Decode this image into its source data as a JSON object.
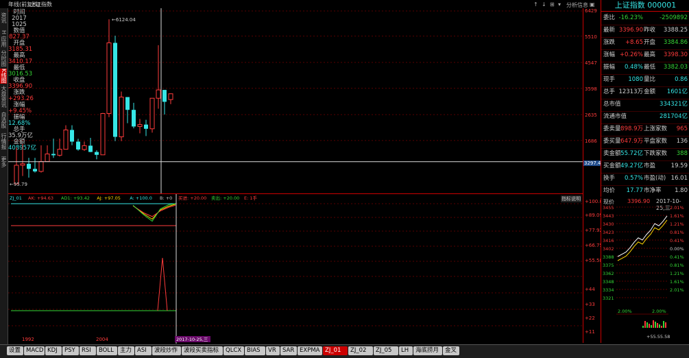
{
  "window": {
    "title": "年线(前复权)",
    "index_name": "上证指数"
  },
  "toolbar": {
    "buttons": [
      "↑",
      "↓",
      "⊞",
      "▾",
      "分析",
      "信息",
      "▣"
    ]
  },
  "left_tabs": [
    "资讯",
    "H 应用",
    "分时图",
    "K线图",
    "大盘资讯",
    "自选股",
    "行情报价",
    "更多"
  ],
  "left_tab_active": 3,
  "info": {
    "time_label": "时间",
    "year": "2017",
    "date": "1025",
    "value_label": "数值",
    "value": "827.37",
    "open_label": "开盘",
    "open": "3185.31",
    "high_label": "最高",
    "high": "3410.17",
    "low_label": "最低",
    "low": "3016.53",
    "close_label": "收盘",
    "close": "3396.90",
    "change_label": "涨跌",
    "change": "+293.26",
    "pct_label": "涨幅",
    "pct": "+9.45%",
    "amp_label": "振幅",
    "amp": "12.68%",
    "vol_label": "总手",
    "vol": "35.9万亿",
    "amount_label": "金额",
    "amount": "408957亿"
  },
  "chart_data": [
    {
      "type": "candlestick",
      "title": "上证指数",
      "period": "年线(前复权)",
      "x_labels": [
        "1992",
        "2004",
        "2017-10-25,三"
      ],
      "ylim": [
        95.79,
        6429
      ],
      "y_ticks": [
        "6429",
        "5510",
        "4547",
        "3598",
        "2635",
        "1686"
      ],
      "crosshair_y": "3297.4",
      "annotations": [
        {
          "label": "6124.04"
        },
        {
          "label": "95.79"
        }
      ],
      "candles": [
        {
          "o": 95,
          "h": 1429,
          "l": 95,
          "c": 780
        },
        {
          "o": 780,
          "h": 1558,
          "l": 386,
          "c": 833
        },
        {
          "o": 833,
          "h": 1052,
          "l": 325,
          "c": 647
        },
        {
          "o": 647,
          "h": 1052,
          "l": 512,
          "c": 555
        },
        {
          "o": 555,
          "h": 1510,
          "l": 512,
          "c": 917
        },
        {
          "o": 917,
          "h": 1510,
          "l": 917,
          "c": 1194
        },
        {
          "o": 1194,
          "h": 1756,
          "l": 1047,
          "c": 1146
        },
        {
          "o": 1146,
          "h": 1756,
          "l": 1100,
          "c": 1366
        },
        {
          "o": 1366,
          "h": 2245,
          "l": 1361,
          "c": 2073
        },
        {
          "o": 2073,
          "h": 2245,
          "l": 1514,
          "c": 1645
        },
        {
          "o": 1645,
          "h": 1748,
          "l": 1311,
          "c": 1357
        },
        {
          "o": 1357,
          "h": 1649,
          "l": 1307,
          "c": 1497
        },
        {
          "o": 1497,
          "h": 1783,
          "l": 1259,
          "c": 1266
        },
        {
          "o": 1266,
          "h": 1328,
          "l": 998,
          "c": 1161
        },
        {
          "o": 1161,
          "h": 2698,
          "l": 1161,
          "c": 2675
        },
        {
          "o": 2675,
          "h": 6124,
          "l": 2541,
          "c": 5261
        },
        {
          "o": 5261,
          "h": 5522,
          "l": 1664,
          "c": 1820
        },
        {
          "o": 1820,
          "h": 3478,
          "l": 1664,
          "c": 3277
        },
        {
          "o": 3277,
          "h": 3186,
          "l": 2319,
          "c": 2808
        },
        {
          "o": 2808,
          "h": 3067,
          "l": 2132,
          "c": 2199
        },
        {
          "o": 2199,
          "h": 2478,
          "l": 1949,
          "c": 2269
        },
        {
          "o": 2269,
          "h": 2444,
          "l": 1849,
          "c": 2115
        },
        {
          "o": 2115,
          "h": 3239,
          "l": 1974,
          "c": 3234
        },
        {
          "o": 3234,
          "h": 5178,
          "l": 2850,
          "c": 3539
        },
        {
          "o": 3539,
          "h": 3538,
          "l": 2638,
          "c": 3103
        },
        {
          "o": 3185,
          "h": 3410,
          "l": 3016,
          "c": 3397
        }
      ]
    },
    {
      "type": "line",
      "title": "ZJ_01",
      "legend": [
        "ZJ_01",
        "AK: +94.63",
        "AD1: +93.42",
        "AJ: +97.05",
        "A: +100.0",
        "B: +0",
        "买进: +20.00",
        "卖出: +20.00",
        "E: 1手"
      ],
      "y_ticks": [
        "+100.0",
        "+89.09",
        "+77.92",
        "+66.75",
        "+55.58",
        "+44",
        "+33",
        "+22",
        "+11"
      ],
      "series": [
        {
          "name": "AK",
          "values": [
            96,
            80,
            70,
            88,
            95,
            99
          ]
        },
        {
          "name": "AD1",
          "values": [
            96,
            82,
            75,
            86,
            93,
            97
          ]
        },
        {
          "name": "AJ",
          "values": [
            97,
            78,
            66,
            90,
            98,
            100
          ]
        }
      ],
      "spike": {
        "name": "B",
        "values": [
          0,
          70,
          0
        ]
      }
    }
  ],
  "panel": {
    "title": "上证指数 000001",
    "rows": [
      {
        "l": "委比",
        "v1": "-16.23%",
        "l2": "",
        "v2": "-2509892",
        "c1": "g",
        "c2": "g"
      },
      {
        "l": "最新",
        "v1": "3396.90",
        "l2": "昨收",
        "v2": "3388.25",
        "c1": "r",
        "c2": "w"
      },
      {
        "l": "涨跌",
        "v1": "+8.65",
        "l2": "开盘",
        "v2": "3384.86",
        "c1": "r",
        "c2": "g"
      },
      {
        "l": "涨幅",
        "v1": "+0.26%",
        "l2": "最高",
        "v2": "3398.30",
        "c1": "r",
        "c2": "r"
      },
      {
        "l": "振幅",
        "v1": "0.48%",
        "l2": "最低",
        "v2": "3382.03",
        "c1": "c",
        "c2": "g"
      },
      {
        "l": "现手",
        "v1": "1080",
        "l2": "量比",
        "v2": "0.86",
        "c1": "c",
        "c2": "c"
      },
      {
        "l": "总手",
        "v1": "12313万",
        "l2": "金额",
        "v2": "1601亿",
        "c1": "w",
        "c2": "c"
      },
      {
        "l": "总市值",
        "v1": "",
        "l2": "",
        "v2": "334321亿",
        "c1": "w",
        "c2": "c"
      },
      {
        "l": "流通市值",
        "v1": "",
        "l2": "",
        "v2": "281704亿",
        "c1": "w",
        "c2": "c"
      },
      {
        "l": "委卖量",
        "v1": "898.9万",
        "l2": "上涨家数",
        "v2": "965",
        "c1": "r",
        "c2": "r"
      },
      {
        "l": "委买量",
        "v1": "647.9万",
        "l2": "平盘家数",
        "v2": "136",
        "c1": "r",
        "c2": "w"
      },
      {
        "l": "卖金额",
        "v1": "55.72亿",
        "l2": "下跌家数",
        "v2": "388",
        "c1": "c",
        "c2": "g"
      },
      {
        "l": "买金额",
        "v1": "49.27亿",
        "l2": "市盈",
        "v2": "19.59",
        "c1": "c",
        "c2": "w"
      },
      {
        "l": "换手",
        "v1": "0.57%",
        "l2": "市盈(动)",
        "v2": "16.01",
        "c1": "c",
        "c2": "w"
      },
      {
        "l": "均价",
        "v1": "17.77",
        "l2": "市净率",
        "v2": "1.80",
        "c1": "c",
        "c2": "w"
      }
    ]
  },
  "mini": {
    "label": "现价",
    "price": "3396.90",
    "date": "2017-10-25,三",
    "y_left": [
      "3455",
      "3443",
      "3430",
      "3423",
      "3416",
      "3402",
      "3388",
      "3375",
      "3362",
      "3348",
      "3334",
      "3321"
    ],
    "y_right": [
      "2.01%",
      "1.61%",
      "1.21%",
      "0.81%",
      "0.41%",
      "0.00%",
      "0.41%",
      "0.81%",
      "1.21%",
      "1.61%",
      "2.01%"
    ],
    "bottom_pct": "2.00%",
    "bottom_pct2": "2.00%",
    "bottom_value": "+55.55.58",
    "line": [
      3388,
      3390,
      3392,
      3396,
      3401,
      3405,
      3403,
      3408,
      3412,
      3418,
      3416,
      3420,
      3425
    ]
  },
  "ind_help": "指标说明",
  "tabs": [
    "设置",
    "MACD",
    "KDJ",
    "PSY",
    "RSI",
    "BOLL",
    "主力",
    "ASI",
    "波段炒作",
    "波段买卖指标",
    "QLCX",
    "BIAS",
    "VR",
    "SAR",
    "EXPMA",
    "ZJ_01",
    "ZJ_02",
    "ZJ_05",
    "LH",
    "海底捞月",
    "金叉"
  ],
  "tab_active": 15,
  "colors": {
    "up": "#ff3b3b",
    "down": "#36e6e6",
    "accent": "#c00000",
    "panel_title": "#36e6e6"
  }
}
